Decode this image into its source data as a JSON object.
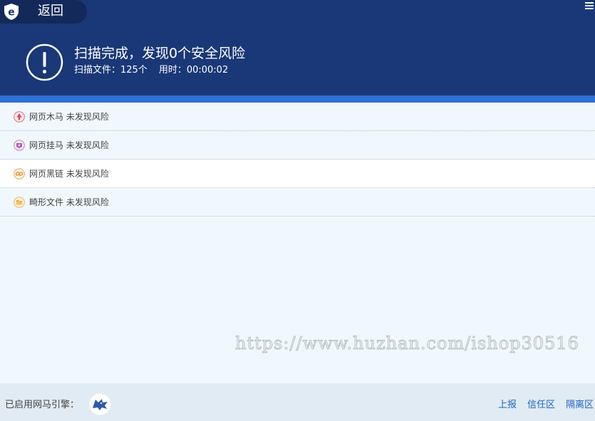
{
  "header": {
    "back_label": "返回",
    "logo_icon": "shield-e-logo",
    "menu_icon": "hamburger-icon",
    "status_icon": "exclamation-circle-icon",
    "title": "扫描完成，发现0个安全风险",
    "files_label": "扫描文件：125个",
    "time_label": "用时：00:00:02",
    "bg_color": "#1a3877",
    "accent_color": "#2f6fd6"
  },
  "results": [
    {
      "icon": "trojan-icon",
      "text": "网页木马 未发现风险"
    },
    {
      "icon": "hanging-horse-icon",
      "text": "网页挂马 未发现风险"
    },
    {
      "icon": "blacklink-icon",
      "text": "网页黑链 未发现风险"
    },
    {
      "icon": "folder-icon",
      "text": "畸形文件 未发现风险"
    }
  ],
  "watermark": "https://www.huzhan.com/ishop30516",
  "footer": {
    "engine_label": "已启用网马引擎：",
    "engine_icon": "wolf-engine-icon",
    "links": [
      "上报",
      "信任区",
      "隔离区"
    ],
    "link_color": "#2065c2"
  }
}
